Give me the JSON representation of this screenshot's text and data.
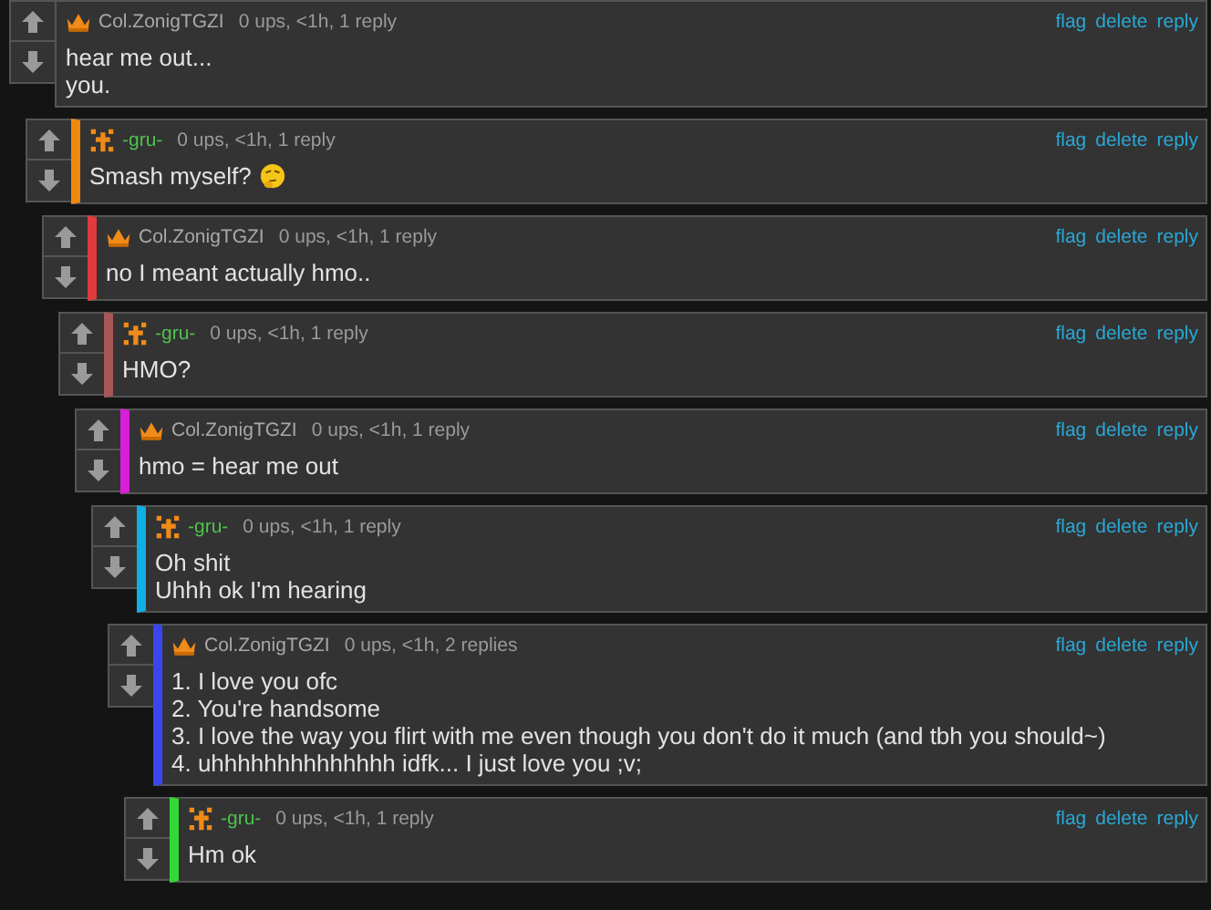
{
  "comments": [
    {
      "author": {
        "name": "Col.ZonigTGZI",
        "kind": "crown"
      },
      "meta": "0 ups, <1h, 1 reply",
      "actions": [
        "flag",
        "delete",
        "reply"
      ],
      "lines": [
        "hear me out...",
        "you."
      ],
      "children": [
        {
          "color": "#f0890a",
          "author": {
            "name": "-gru-",
            "kind": "cross"
          },
          "meta": "0 ups, <1h, 1 reply",
          "actions": [
            "flag",
            "delete",
            "reply"
          ],
          "lines": [
            "Smash myself?"
          ],
          "trailing_emoji": true,
          "children": [
            {
              "color": "#e03a3a",
              "author": {
                "name": "Col.ZonigTGZI",
                "kind": "crown"
              },
              "meta": "0 ups, <1h, 1 reply",
              "actions": [
                "flag",
                "delete",
                "reply"
              ],
              "lines": [
                "no I meant actually hmo.."
              ],
              "children": [
                {
                  "color": "#a85656",
                  "author": {
                    "name": "-gru-",
                    "kind": "cross"
                  },
                  "meta": "0 ups, <1h, 1 reply",
                  "actions": [
                    "flag",
                    "delete",
                    "reply"
                  ],
                  "lines": [
                    "HMO?"
                  ],
                  "children": [
                    {
                      "color": "#d81ed8",
                      "author": {
                        "name": "Col.ZonigTGZI",
                        "kind": "crown"
                      },
                      "meta": "0 ups, <1h, 1 reply",
                      "actions": [
                        "flag",
                        "delete",
                        "reply"
                      ],
                      "lines": [
                        "hmo = hear me out"
                      ],
                      "children": [
                        {
                          "color": "#12aee6",
                          "author": {
                            "name": "-gru-",
                            "kind": "cross"
                          },
                          "meta": "0 ups, <1h, 1 reply",
                          "actions": [
                            "flag",
                            "delete",
                            "reply"
                          ],
                          "lines": [
                            "Oh shit",
                            "Uhhh ok I'm hearing"
                          ],
                          "children": [
                            {
                              "color": "#3846f2",
                              "author": {
                                "name": "Col.ZonigTGZI",
                                "kind": "crown"
                              },
                              "meta": "0 ups, <1h, 2 replies",
                              "actions": [
                                "flag",
                                "delete",
                                "reply"
                              ],
                              "lines": [
                                "1. I love you ofc",
                                "2. You're handsome",
                                "3. I love the way you flirt with me even though you don't do it much (and tbh you should~)",
                                "4. uhhhhhhhhhhhhhh idfk... I just love you ;v;"
                              ],
                              "children": [
                                {
                                  "color": "#34d834",
                                  "author": {
                                    "name": "-gru-",
                                    "kind": "cross"
                                  },
                                  "meta": "0 ups, <1h, 1 reply",
                                  "actions": [
                                    "flag",
                                    "delete",
                                    "reply"
                                  ],
                                  "lines": [
                                    "Hm ok"
                                  ]
                                }
                              ]
                            }
                          ]
                        }
                      ]
                    }
                  ]
                }
              ]
            }
          ]
        }
      ]
    }
  ]
}
